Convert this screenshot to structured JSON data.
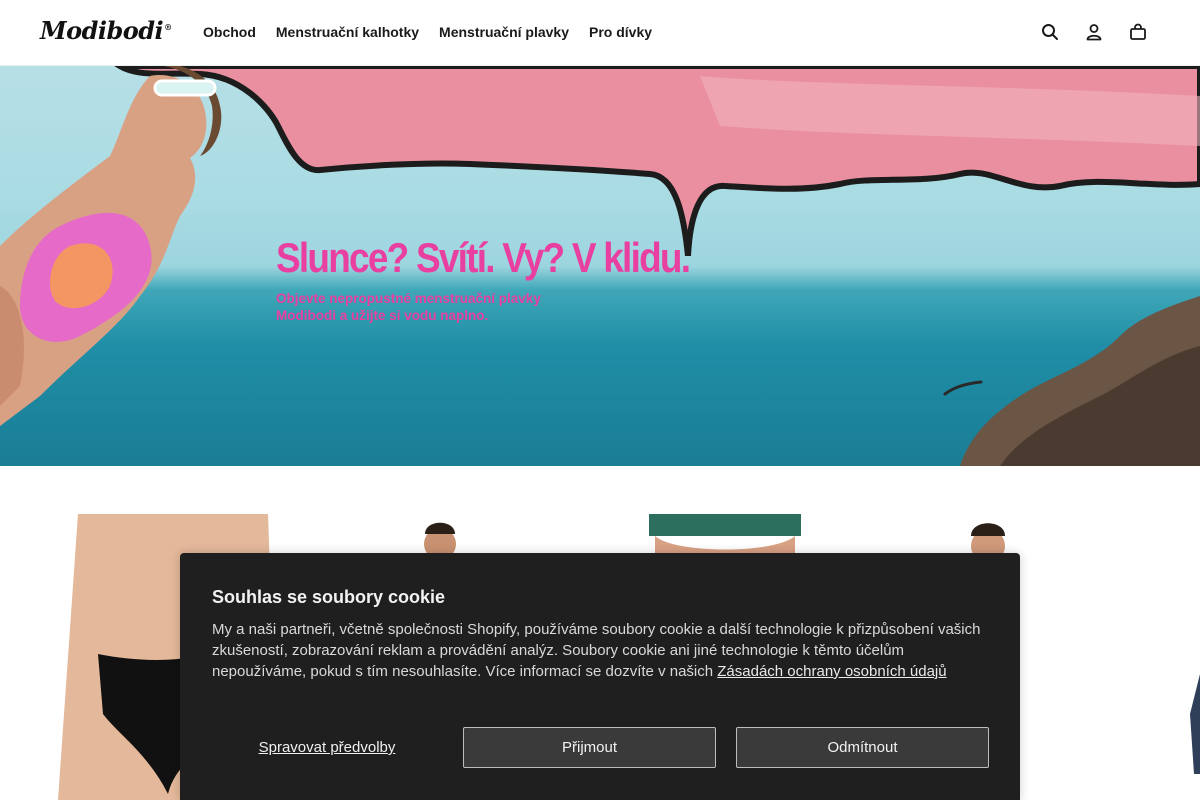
{
  "header": {
    "logo": "Modibodi",
    "logo_mark": "®",
    "nav": [
      {
        "label": "Obchod"
      },
      {
        "label": "Menstruační kalhotky"
      },
      {
        "label": "Menstruační plavky"
      },
      {
        "label": "Pro dívky"
      }
    ],
    "icons": [
      "search-icon",
      "account-icon",
      "cart-icon"
    ]
  },
  "hero": {
    "title": "Slunce? Svítí. Vy? V klidu.",
    "subtitle_line1": "Objevte nepropustné menstruační plavky",
    "subtitle_line2": "Modibodi a užijte si vodu naplno.",
    "accent_color": "#e83fa0"
  },
  "cookie": {
    "title": "Souhlas se soubory cookie",
    "text": "My a naši partneři, včetně společnosti Shopify, používáme soubory cookie a další technologie k přizpůsobení vašich zkušeností, zobrazování reklam a provádění analýz. Soubory cookie ani jiné technologie k těmto účelům nepoužíváme, pokud s tím nesouhlasíte. Více informací se dozvíte v našich ",
    "policy_link": "Zásadách ochrany osobních údajů",
    "manage_label": "Spravovat předvolby",
    "accept_label": "Přijmout",
    "decline_label": "Odmítnout"
  }
}
